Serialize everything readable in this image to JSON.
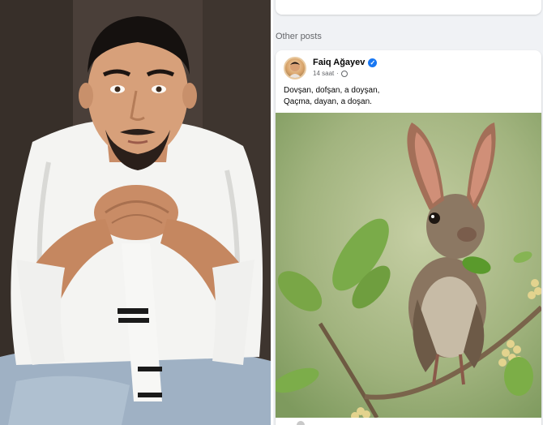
{
  "section": {
    "label": "Other posts"
  },
  "post": {
    "author": "Faiq Ağayev",
    "time": "14 saat",
    "lines": [
      "Dovşan, dofşan, a doyşan,",
      "Qaçma, dayan, a doşan."
    ]
  },
  "icons": {
    "verified": "verified-badge-icon",
    "audience": "globe-icon",
    "avatar": "avatar"
  },
  "colors": {
    "page_background": "#f0f2f5",
    "card_background": "#ffffff",
    "secondary_text": "#65676b",
    "verified_blue": "#1877f2"
  }
}
